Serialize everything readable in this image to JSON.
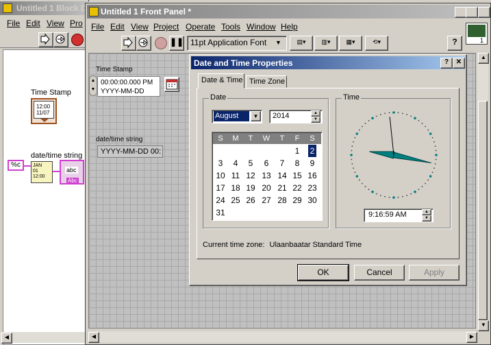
{
  "block_diagram": {
    "title": "Untitled 1 Block D",
    "menu": [
      "File",
      "Edit",
      "View",
      "Pro"
    ],
    "time_stamp_label": "Time Stamp",
    "datetime_string_label": "date/time string",
    "format_const": "%c",
    "clock_node_text": "12:00\n11/07",
    "format_node_text": "JAN\n01\n12:00",
    "string_indicator_text": "abc",
    "string_indicator_sub": "Abc"
  },
  "front_panel": {
    "title": "Untitled 1 Front Panel *",
    "menu": [
      "File",
      "Edit",
      "View",
      "Project",
      "Operate",
      "Tools",
      "Window",
      "Help"
    ],
    "font_select": "11pt Application Font",
    "time_stamp_label": "Time Stamp",
    "time_stamp_value_line1": "00:00:00.000 PM",
    "time_stamp_value_line2": "YYYY-MM-DD",
    "datetime_string_label": "date/time string",
    "datetime_string_value": "YYYY-MM-DD 00:",
    "help_button": "?",
    "vi_icon_number": "1"
  },
  "dialog": {
    "title": "Date and Time Properties",
    "help_btn": "?",
    "close_btn": "✕",
    "tabs": [
      "Date & Time",
      "Time Zone"
    ],
    "date_group": "Date",
    "time_group": "Time",
    "month": "August",
    "year": "2014",
    "weekday_headers": [
      "S",
      "M",
      "T",
      "W",
      "T",
      "F",
      "S"
    ],
    "days": [
      "1",
      "2",
      "3",
      "4",
      "5",
      "6",
      "7",
      "8",
      "9",
      "10",
      "11",
      "12",
      "13",
      "14",
      "15",
      "16",
      "17",
      "18",
      "19",
      "20",
      "21",
      "22",
      "23",
      "24",
      "25",
      "26",
      "27",
      "28",
      "29",
      "30",
      "31"
    ],
    "selected_day": "2",
    "time_value": "9:16:59 AM",
    "timezone_label": "Current time zone:",
    "timezone_value": "Ulaanbaatar Standard Time",
    "ok": "OK",
    "cancel": "Cancel",
    "apply": "Apply"
  },
  "colors": {
    "title_active": "#0a246a",
    "calendar_header": "#808080",
    "selected_day_bg": "#0a246a",
    "clock_hand": "#008080"
  }
}
